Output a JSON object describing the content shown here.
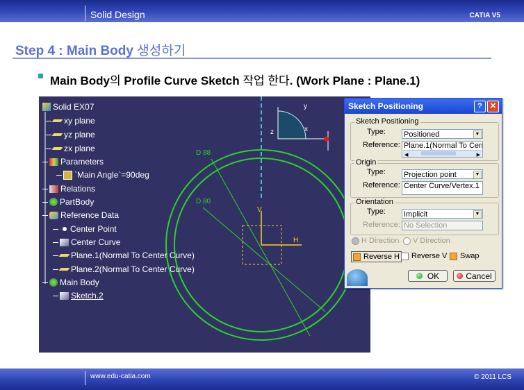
{
  "header": {
    "title": "Solid Design",
    "brand": "CATIA V5"
  },
  "step": {
    "prefix": "Step 4 : Main Body ",
    "korean": "생성하기"
  },
  "description": {
    "part1": "Main Body",
    "part2": "의 ",
    "part3": "Profile Curve Sketch ",
    "part4": "작업 한다",
    "part5": ". (Work Plane : Plane.1)"
  },
  "tree": {
    "root": "Solid EX07",
    "items": [
      {
        "label": "xy plane",
        "icon": "plane-icon"
      },
      {
        "label": "yz plane",
        "icon": "plane-icon"
      },
      {
        "label": "zx plane",
        "icon": "plane-icon"
      },
      {
        "label": "Parameters",
        "icon": "parameters-icon"
      },
      {
        "label": "`Main Angle`=90deg",
        "icon": "angle-parameter-icon"
      },
      {
        "label": "Relations",
        "icon": "relations-icon"
      },
      {
        "label": "PartBody",
        "icon": "partbody-icon"
      },
      {
        "label": "Reference Data",
        "icon": "geometrical-set-icon"
      },
      {
        "label": "Center Point",
        "icon": "point-icon"
      },
      {
        "label": "Center Curve",
        "icon": "sketch-icon"
      },
      {
        "label": "Plane.1(Normal To Center Curve)",
        "icon": "plane-icon"
      },
      {
        "label": "Plane.2(Normal To Center Curve)",
        "icon": "plane-icon"
      },
      {
        "label": "Main Body",
        "icon": "body-icon"
      },
      {
        "label": "Sketch.2",
        "icon": "sketch-icon"
      }
    ]
  },
  "viewport": {
    "dim_outer": "D 88",
    "dim_inner": "D 80",
    "axis_h": "H",
    "axis_v": "V",
    "compass_y": "y",
    "compass_z": "z",
    "compass_x": "x"
  },
  "dialog": {
    "title": "Sketch Positioning",
    "help": "?",
    "close": "✕",
    "sketch_positioning": {
      "group_label": "Sketch Positioning",
      "type_label": "Type:",
      "type_value": "Positioned",
      "reference_label": "Reference:",
      "reference_value": "Plane.1(Normal To Cen"
    },
    "origin": {
      "group_label": "Origin",
      "type_label": "Type:",
      "type_value": "Projection point",
      "reference_label": "Reference:",
      "reference_value": "Center Curve/Vertex.1"
    },
    "orientation": {
      "group_label": "Orientation",
      "type_label": "Type:",
      "type_value": "Implicit",
      "reference_label": "Reference:",
      "reference_value": "No Selection",
      "h_direction": "H Direction",
      "v_direction": "V Direction",
      "reverse_h": "Reverse H",
      "reverse_v": "Reverse V",
      "swap": "Swap"
    },
    "ok": "OK",
    "cancel": "Cancel"
  },
  "footer": {
    "website": "www.edu-catia.com",
    "copyright": "© 2011 LCS"
  },
  "colors": {
    "header_blue": "#3146b8",
    "step_text": "#5b72d4",
    "viewport_bg": "#323163",
    "sketch_green": "#29d429",
    "axis_yellow": "#ffd21e",
    "dialog_title": "#1a46d0"
  }
}
